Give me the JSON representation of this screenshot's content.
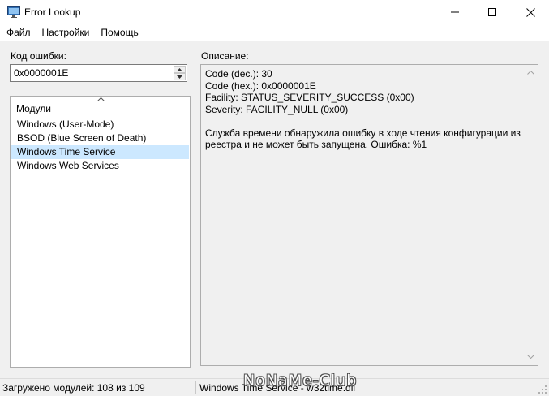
{
  "window": {
    "title": "Error Lookup",
    "controls": {
      "minimize": "minimize",
      "maximize": "maximize",
      "close": "close"
    }
  },
  "menu": {
    "items": [
      {
        "label": "Файл"
      },
      {
        "label": "Настройки"
      },
      {
        "label": "Помощь"
      }
    ]
  },
  "code": {
    "label": "Код ошибки:",
    "value": "0x0000001E"
  },
  "modules": {
    "header": "Модули",
    "items": [
      {
        "label": "Windows (User-Mode)",
        "selected": false
      },
      {
        "label": "BSOD (Blue Screen of Death)",
        "selected": false
      },
      {
        "label": "Windows Time Service",
        "selected": true
      },
      {
        "label": "Windows Web Services",
        "selected": false
      }
    ]
  },
  "description": {
    "label": "Описание:",
    "text": "Code (dec.): 30\nCode (hex.): 0x0000001E\nFacility: STATUS_SEVERITY_SUCCESS (0x00)\nSeverity: FACILITY_NULL (0x00)\n\nСлужба времени обнаружила ошибку в ходе чтения конфигурации из реестра и не может быть запущена. Ошибка: %1"
  },
  "status": {
    "left": "Загружено модулей: 108 из 109",
    "right": "Windows Time Service - w32time.dll"
  },
  "watermark": "NoNaMe-Club",
  "colors": {
    "selection": "#cce8ff",
    "window_bg": "#f0f0f0",
    "titlebar_bg": "#ffffff"
  }
}
